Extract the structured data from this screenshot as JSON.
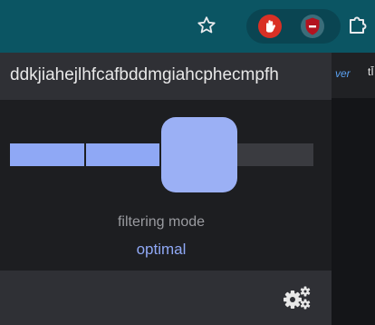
{
  "toolbar": {
    "icons": [
      "star-icon",
      "hand-icon",
      "shield-icon",
      "puzzle-icon"
    ],
    "colors": {
      "background": "#0b5563",
      "hand_badge": "#d93025",
      "shield_badge": "#b3121f"
    }
  },
  "background_page": {
    "partial_text_1": "ver",
    "partial_text_2": "tĪ"
  },
  "popup": {
    "hostname": "ddkjiahejlhfcafbddmgiahcphecmpfh",
    "filtering": {
      "label": "filtering mode",
      "value": "optimal",
      "level": 3,
      "levels": 4
    },
    "footer": {
      "icon": "gears-icon"
    },
    "colors": {
      "accent": "#8fa8f5",
      "header_bg": "#2f3035",
      "body_bg": "#1d1e21"
    }
  }
}
